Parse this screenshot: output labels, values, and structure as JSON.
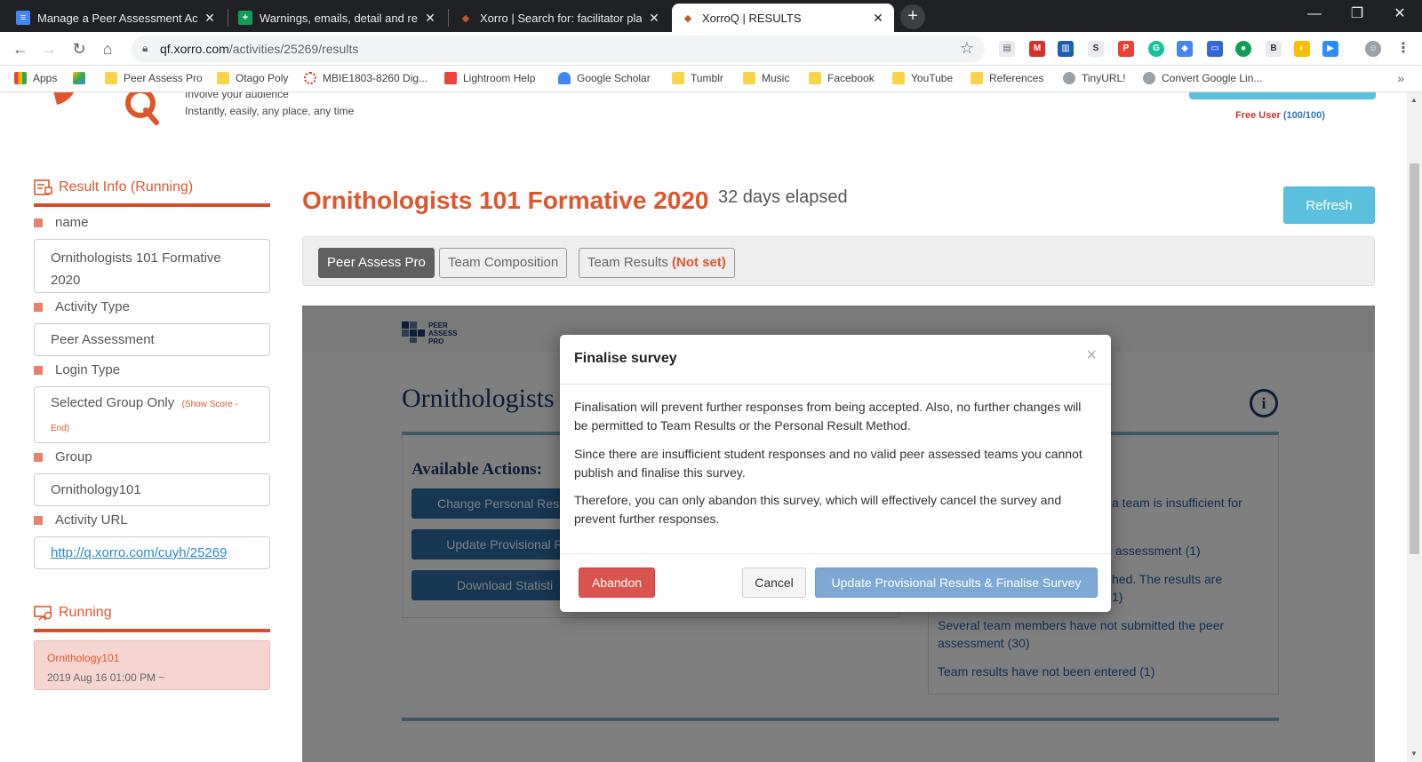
{
  "browser": {
    "tabs": [
      {
        "title": "Manage a Peer Assessment Activ",
        "icon": "docs-icon",
        "color": "#4285f4",
        "active": false
      },
      {
        "title": "Warnings, emails, detail and rem",
        "icon": "sheets-plus-icon",
        "color": "#0f9d58",
        "active": false
      },
      {
        "title": "Xorro | Search for: facilitator plan",
        "icon": "xorro-fox-icon",
        "color": "#c05a2a",
        "active": false
      },
      {
        "title": "XorroQ | RESULTS",
        "icon": "xorro-fox-icon",
        "color": "#c05a2a",
        "active": true
      }
    ],
    "url_host": "qf.xorro.com",
    "url_path": "/activities/25269/results",
    "bookmarks": [
      "Apps",
      "Peer Assess Pro",
      "Otago Poly",
      "MBIE1803-8260 Dig...",
      "Lightroom Help",
      "Google Scholar",
      "Tumblr",
      "Music",
      "Facebook",
      "YouTube",
      "References",
      "TinyURL!",
      "Convert Google Lin..."
    ]
  },
  "header": {
    "tagline_1": "Involve your audience",
    "tagline_2": "Instantly, easily, any place, any time",
    "free_user_label": "Free User",
    "free_user_count": "(100/100)"
  },
  "sidebar": {
    "result_info_title": "Result Info (Running)",
    "name_label": "name",
    "name_value": "Ornithologists 101 Formative 2020",
    "activity_type_label": "Activity Type",
    "activity_type_value": "Peer Assessment",
    "login_type_label": "Login Type",
    "login_type_value": "Selected Group Only",
    "login_type_note": "(Show Score - End)",
    "group_label": "Group",
    "group_value": "Ornithology101",
    "activity_url_label": "Activity URL",
    "activity_url_value": "http://q.xorro.com/cuyh/25269",
    "running_title": "Running",
    "running_group": "Ornithology101",
    "running_date": "2019 Aug 16 01:00 PM ~"
  },
  "main": {
    "title": "Ornithologists 101 Formative 2020",
    "elapsed": "32 days elapsed",
    "refresh_label": "Refresh",
    "tabs": {
      "peer_assess_pro": "Peer Assess Pro",
      "team_composition": "Team Composition",
      "team_results": "Team Results",
      "team_results_status": "(Not set)"
    }
  },
  "embedded": {
    "logo_text_1": "PEER",
    "logo_text_2": "ASSESS",
    "logo_text_3": "PRO",
    "title_visible": "Ornithologists",
    "available_actions": "Available Actions:",
    "btn_change": "Change Personal Result",
    "btn_update": "Update Provisional R",
    "btn_download": "Download Statisti",
    "issue_1": "a team is insufficient for",
    "issue_2": "assessment (1)",
    "issue_3a": "hed. The results are",
    "issue_3b": "1)",
    "issue_4": "Several team members have not submitted the peer assessment (30)",
    "issue_5": "Team results have not been entered (1)"
  },
  "modal": {
    "title": "Finalise survey",
    "close": "×",
    "para_1": "Finalisation will prevent further responses from being accepted. Also, no further changes will be permitted to Team Results or the Personal Result Method.",
    "para_2": "Since there are insufficient student responses and no valid peer assessed teams you cannot publish and finalise this survey.",
    "para_3": "Therefore, you can only abandon this survey, which will effectively cancel the survey and prevent further responses.",
    "abandon_label": "Abandon",
    "cancel_label": "Cancel",
    "finalise_label": "Update Provisional Results & Finalise Survey"
  },
  "colors": {
    "brand_orange": "#e0562c",
    "info_blue": "#5bc0de",
    "danger": "#d9534f",
    "primary_disabled": "#7fa7d4"
  }
}
